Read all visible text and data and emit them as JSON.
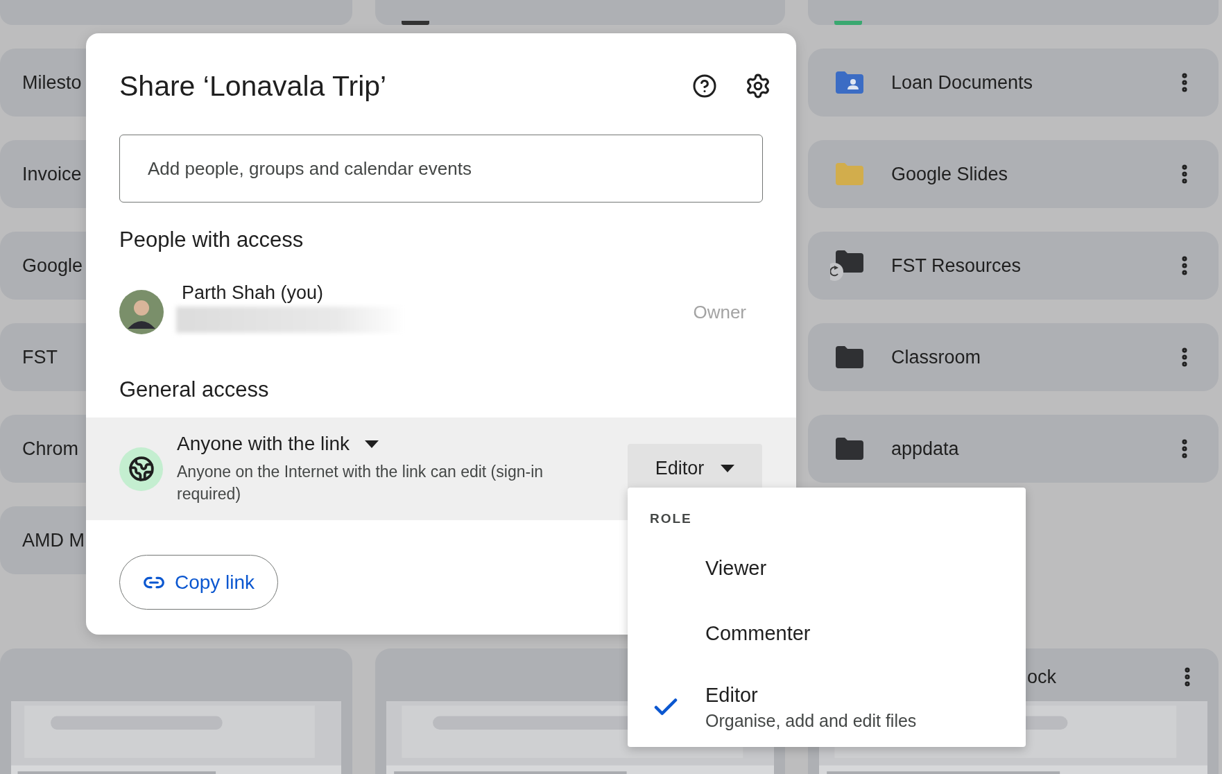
{
  "drive": {
    "left_items": [
      {
        "name": "Milesto"
      },
      {
        "name": "Invoice"
      },
      {
        "name": "Google"
      },
      {
        "name": "FST"
      },
      {
        "name": "Chrom"
      },
      {
        "name": "AMD M"
      }
    ],
    "right_items": [
      {
        "name": "Loan Documents",
        "kind": "shared",
        "color": "#3b6cc4"
      },
      {
        "name": "Google Slides",
        "kind": "plain",
        "color": "#d2ad4c"
      },
      {
        "name": "FST Resources",
        "kind": "syncing",
        "color": "#2f3033"
      },
      {
        "name": "Classroom",
        "kind": "plain",
        "color": "#2f3033"
      },
      {
        "name": "appdata",
        "kind": "plain",
        "color": "#2f3033"
      }
    ],
    "bottom_cards": [
      {
        "thumbnail": {
          "kind": "picture"
        }
      },
      {
        "thumbnail": {
          "kind": "picture"
        }
      },
      {
        "title": "ock",
        "thumbnail": {
          "kind": "picture"
        }
      }
    ]
  },
  "dialog": {
    "title": "Share ‘Lonavala Trip’",
    "input": {
      "placeholder": "Add people, groups and calendar events"
    },
    "people_heading": "People with access",
    "people": [
      {
        "name": "Parth Shah (you)",
        "role": "Owner"
      }
    ],
    "general_access_heading": "General access",
    "general_access": {
      "scope": "Anyone with the link",
      "description": "Anyone on the Internet with the link can edit (sign-in required)",
      "role": "Editor"
    },
    "copy_link": "Copy link"
  },
  "role_menu": {
    "heading": "ROLE",
    "options": [
      {
        "label": "Viewer",
        "selected": false
      },
      {
        "label": "Commenter",
        "selected": false
      },
      {
        "label": "Editor",
        "selected": true,
        "description": "Organise, add and edit files"
      }
    ]
  }
}
